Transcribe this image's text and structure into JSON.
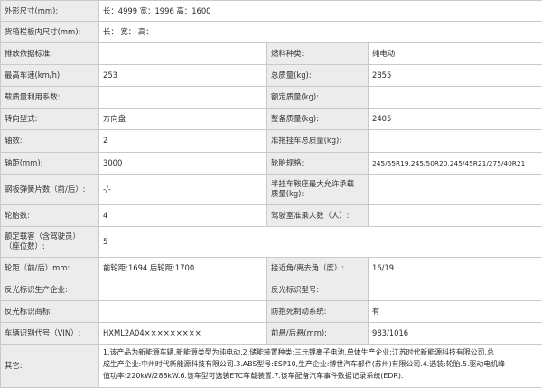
{
  "rows": [
    {
      "l1": "外形尺寸(mm):",
      "v1": "长：4999 宽：1996 高：1600"
    },
    {
      "l1": "货箱栏板内尺寸(mm):",
      "v1": "长： 宽： 高："
    },
    {
      "l1": "排放依据标准:",
      "v1": "",
      "l2": "燃料种类:",
      "v2": "纯电动"
    },
    {
      "l1": "最高车速(km/h):",
      "v1": "253",
      "l2": "总质量(kg):",
      "v2": "2855"
    },
    {
      "l1": "载质量利用系数:",
      "v1": "",
      "l2": "额定质量(kg):",
      "v2": ""
    },
    {
      "l1": "转向型式:",
      "v1": "方向盘",
      "l2": "整备质量(kg):",
      "v2": "2405"
    },
    {
      "l1": "轴数:",
      "v1": "2",
      "l2": "准拖挂车总质量(kg):",
      "v2": ""
    },
    {
      "l1": "轴距(mm):",
      "v1": "3000",
      "l2": "轮胎规格:",
      "v2": "245/55R19,245/50R20,245/45R21/275/40R21"
    },
    {
      "l1": "钢板弹簧片数（前/后）:",
      "v1": "-/-",
      "l2a": "半挂车鞍座最大允许承载",
      "l2b": "质量(kg):",
      "v2": ""
    },
    {
      "l1": "轮胎数:",
      "v1": "4",
      "l2": "驾驶室准乘人数（人）:",
      "v2": ""
    },
    {
      "l1a": "额定载客（含驾驶员）",
      "l1b": "（座位数）:",
      "v1": "5"
    },
    {
      "l1": "轮距（前/后）mm:",
      "v1": "前轮距:1694 后轮距:1700",
      "l2": "接近角/离去角（度）:",
      "v2": "16/19"
    },
    {
      "l1": "反光标识生产企业:",
      "v1": "",
      "l2": "反光标识型号:",
      "v2": ""
    },
    {
      "l1": "反光标识商标:",
      "v1": "",
      "l2": "防抱死制动系统:",
      "v2": "有"
    },
    {
      "l1": "车辆识别代号（VIN）:",
      "v1": "HXML2A04×××××××××",
      "l2": "前悬/后悬(mm):",
      "v2": "983/1016"
    },
    {
      "l1": "其它:",
      "v1a": "1.该产品为新能源车辆,新能源类型为纯电动.2.储能装置种类:三元锂离子电池,单体生产企业:江苏时代新能源科技有限公司,总",
      "v1b": "成生产企业:中州时代新能源科技有限公司.3.ABS型号:ESP10,生产企业:博世汽车部件(苏州)有限公司.4.选装:轮胎.5.驱动电机峰",
      "v1c": "值功率:220kW/288kW.6.该车型可选装ETC车载装置.7.该车配备汽车事件数据记录系统(EDR)."
    }
  ]
}
